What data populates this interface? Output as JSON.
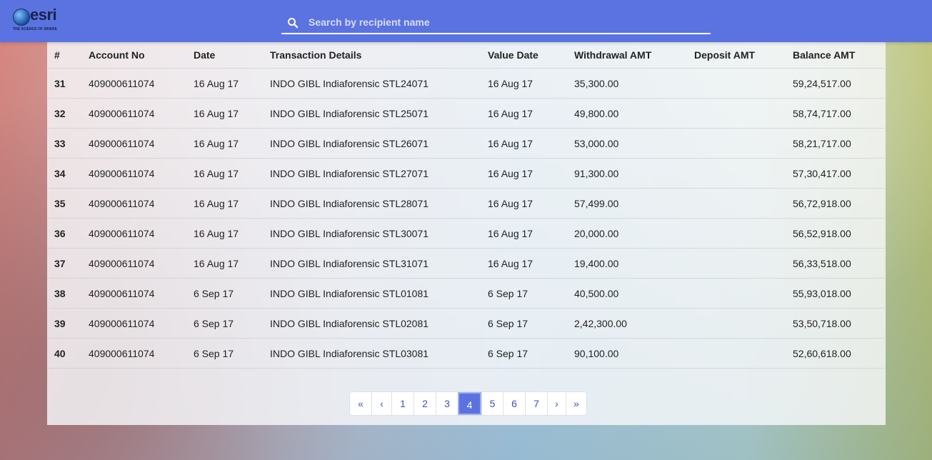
{
  "header": {
    "logo_text": "esri",
    "logo_tagline": "THE SCIENCE OF WHERE",
    "search_placeholder": "Search by recipient name",
    "search_value": ""
  },
  "table": {
    "columns": [
      "#",
      "Account No",
      "Date",
      "Transaction Details",
      "Value Date",
      "Withdrawal AMT",
      "Deposit AMT",
      "Balance AMT"
    ],
    "rows": [
      [
        "31",
        "409000611074",
        "16 Aug 17",
        "INDO GIBL Indiaforensic STL24071",
        "16 Aug 17",
        "35,300.00",
        "",
        "59,24,517.00"
      ],
      [
        "32",
        "409000611074",
        "16 Aug 17",
        "INDO GIBL Indiaforensic STL25071",
        "16 Aug 17",
        "49,800.00",
        "",
        "58,74,717.00"
      ],
      [
        "33",
        "409000611074",
        "16 Aug 17",
        "INDO GIBL Indiaforensic STL26071",
        "16 Aug 17",
        "53,000.00",
        "",
        "58,21,717.00"
      ],
      [
        "34",
        "409000611074",
        "16 Aug 17",
        "INDO GIBL Indiaforensic STL27071",
        "16 Aug 17",
        "91,300.00",
        "",
        "57,30,417.00"
      ],
      [
        "35",
        "409000611074",
        "16 Aug 17",
        "INDO GIBL Indiaforensic STL28071",
        "16 Aug 17",
        "57,499.00",
        "",
        "56,72,918.00"
      ],
      [
        "36",
        "409000611074",
        "16 Aug 17",
        "INDO GIBL Indiaforensic STL30071",
        "16 Aug 17",
        "20,000.00",
        "",
        "56,52,918.00"
      ],
      [
        "37",
        "409000611074",
        "16 Aug 17",
        "INDO GIBL Indiaforensic STL31071",
        "16 Aug 17",
        "19,400.00",
        "",
        "56,33,518.00"
      ],
      [
        "38",
        "409000611074",
        "6 Sep 17",
        "INDO GIBL Indiaforensic STL01081",
        "6 Sep 17",
        "40,500.00",
        "",
        "55,93,018.00"
      ],
      [
        "39",
        "409000611074",
        "6 Sep 17",
        "INDO GIBL Indiaforensic STL02081",
        "6 Sep 17",
        "2,42,300.00",
        "",
        "53,50,718.00"
      ],
      [
        "40",
        "409000611074",
        "6 Sep 17",
        "INDO GIBL Indiaforensic STL03081",
        "6 Sep 17",
        "90,100.00",
        "",
        "52,60,618.00"
      ]
    ]
  },
  "pagination": {
    "first": "«",
    "prev": "‹",
    "pages": [
      "1",
      "2",
      "3",
      "4",
      "5",
      "6",
      "7"
    ],
    "current": "4",
    "next": "›",
    "last": "»"
  },
  "colors": {
    "header_bg": "#5b73e0",
    "active_page_bg": "#5b73e0",
    "link": "#3f51b5"
  }
}
